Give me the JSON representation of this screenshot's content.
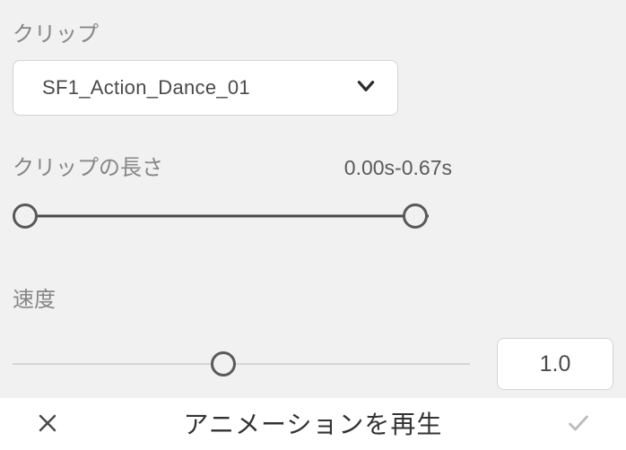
{
  "clip": {
    "label": "クリップ",
    "selected": "SF1_Action_Dance_01"
  },
  "clipLength": {
    "label": "クリップの長さ",
    "rangeText": "0.00s-0.67s"
  },
  "speed": {
    "label": "速度",
    "value": "1.0"
  },
  "bottomBar": {
    "title": "アニメーションを再生"
  }
}
